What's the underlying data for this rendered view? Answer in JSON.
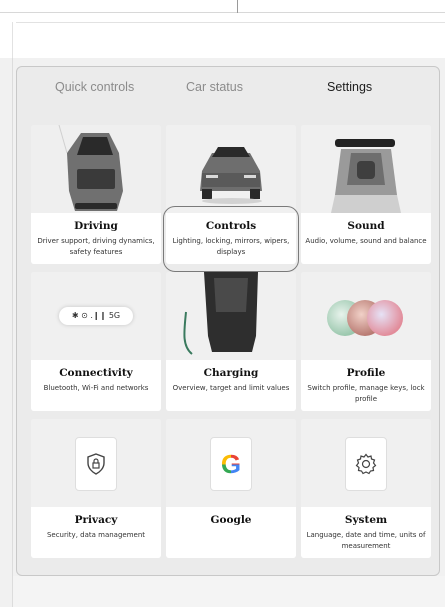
{
  "tabs": [
    {
      "label": "Quick controls",
      "active": false
    },
    {
      "label": "Car status",
      "active": false
    },
    {
      "label": "Settings",
      "active": true
    }
  ],
  "tiles": {
    "driving": {
      "title": "Driving",
      "subtitle": "Driver support, driving dynamics, safety features"
    },
    "controls": {
      "title": "Controls",
      "subtitle": "Lighting, locking, mirrors, wipers, displays"
    },
    "sound": {
      "title": "Sound",
      "subtitle": "Audio, volume, sound and balance"
    },
    "connectivity": {
      "title": "Connectivity",
      "subtitle": "Bluetooth, Wi-Fi and networks",
      "chip_text": "✱ ⊙ .❙❙ 5G"
    },
    "charging": {
      "title": "Charging",
      "subtitle": "Overview, target and limit values"
    },
    "profile": {
      "title": "Profile",
      "subtitle": "Switch profile, manage keys, lock profile"
    },
    "privacy": {
      "title": "Privacy",
      "subtitle": "Security, data management"
    },
    "google": {
      "title": "Google",
      "subtitle": "",
      "logo_letter": "G"
    },
    "system": {
      "title": "System",
      "subtitle": "Language, date and time, units of measurement"
    }
  },
  "colors": {
    "active_tab": "#1d1d1d",
    "inactive_tab": "#8b8b8b",
    "google_blue": "#4285f4",
    "google_red": "#ea4335",
    "google_yellow": "#fbbc05",
    "google_green": "#34a853"
  },
  "icons": {
    "privacy": "shield-lock-icon",
    "system": "gear-icon",
    "google": "google-logo-icon",
    "connectivity": "bluetooth-wifi-signal-icon"
  }
}
